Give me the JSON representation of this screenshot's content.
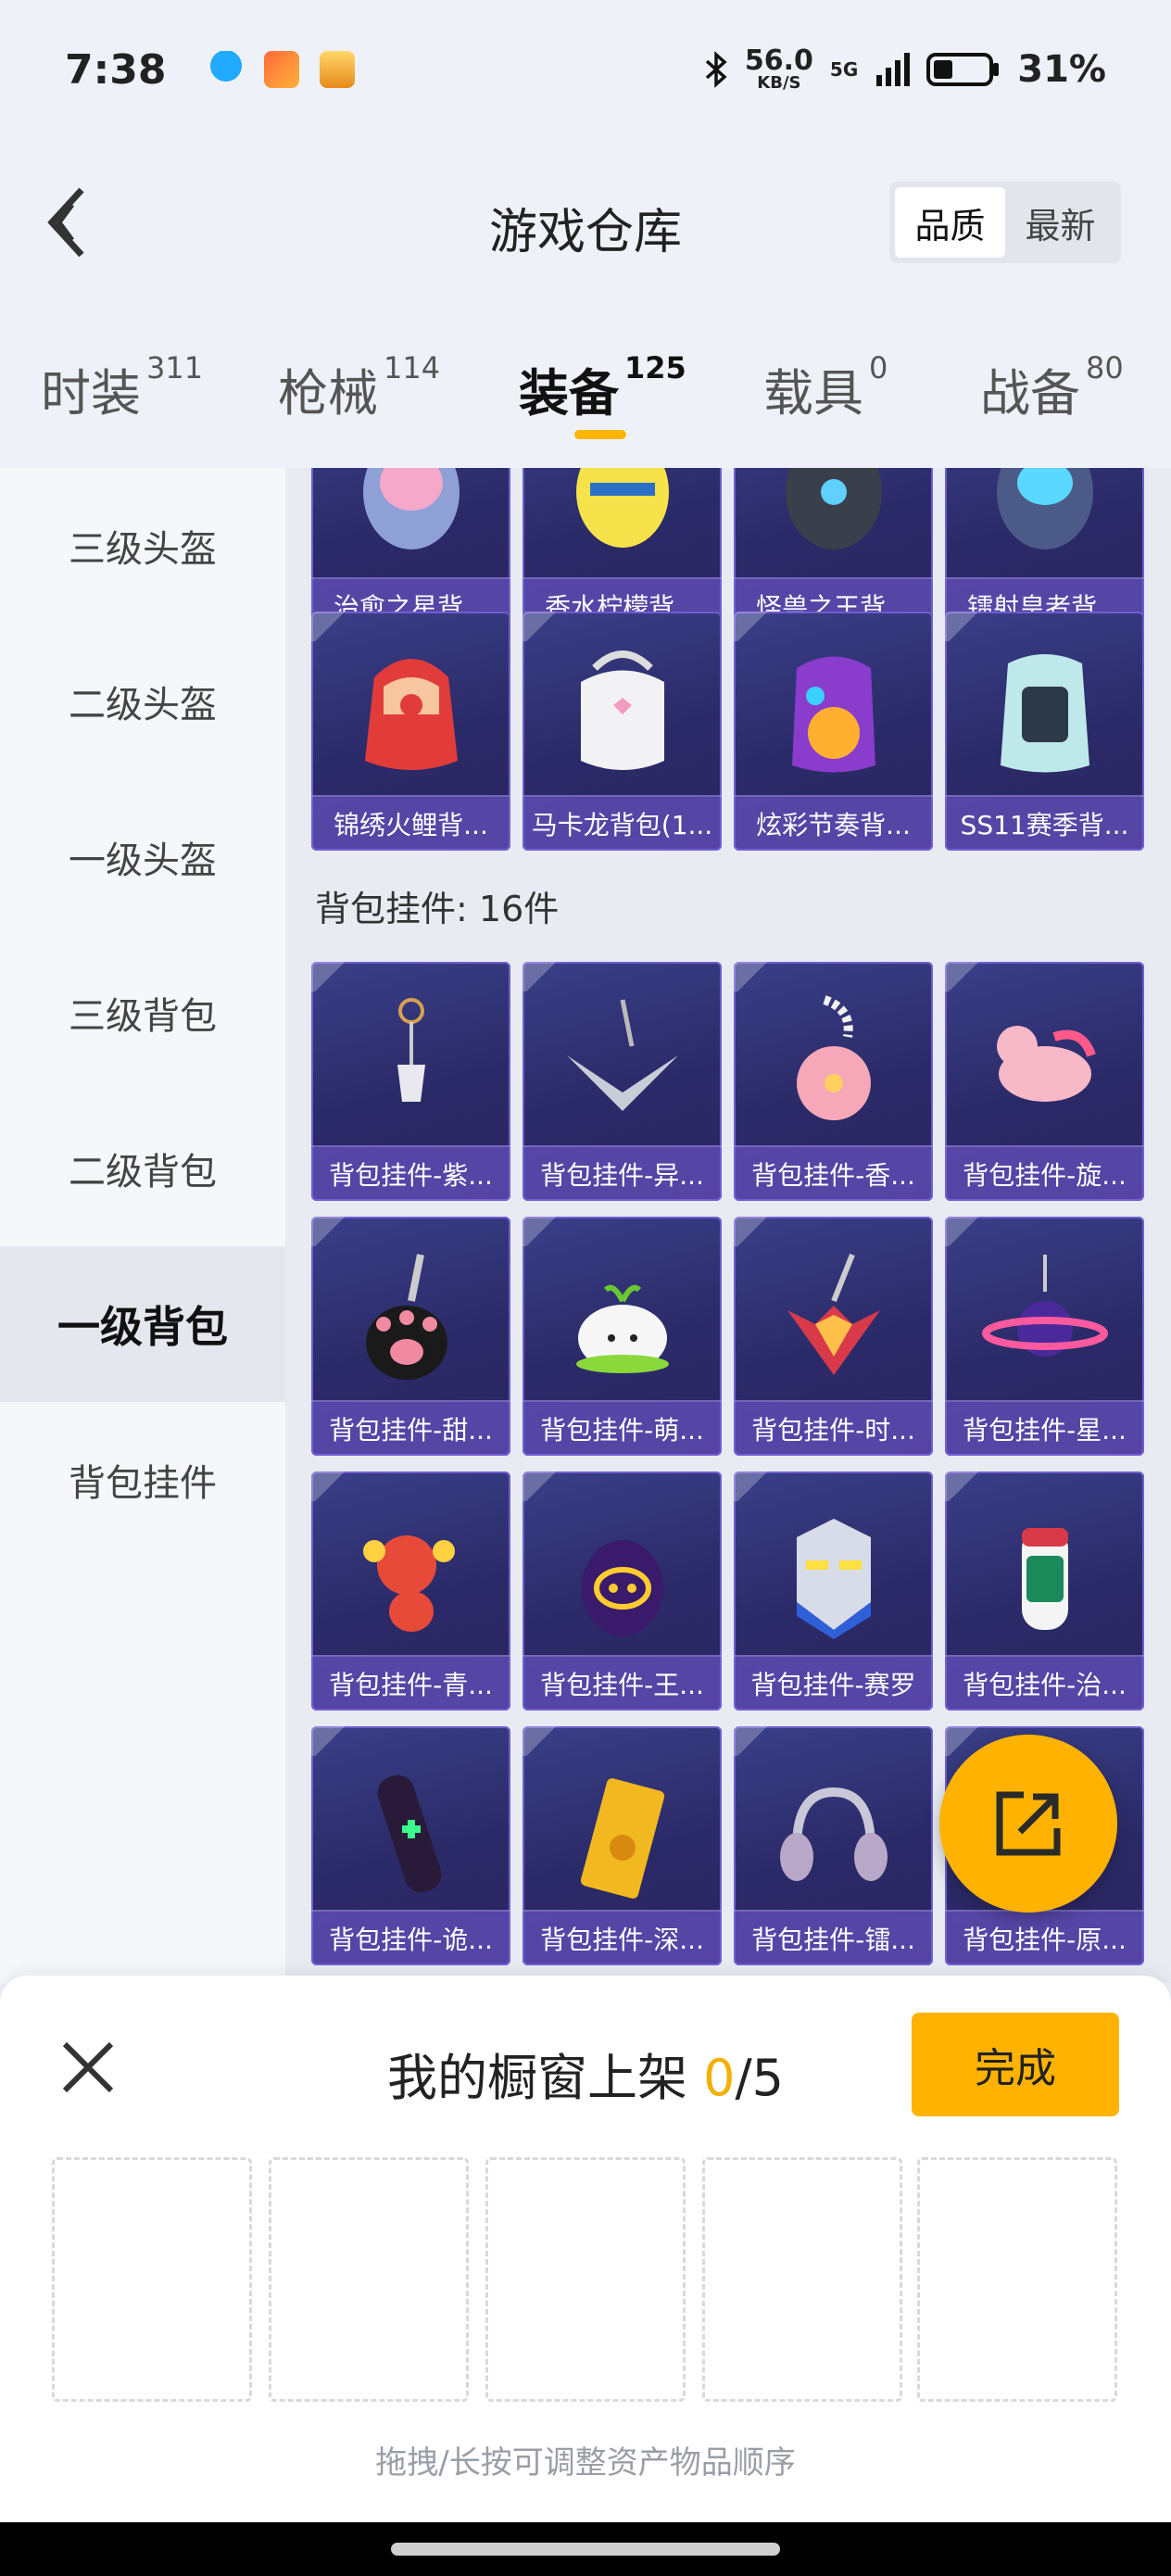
{
  "status_bar": {
    "time": "7:38",
    "net_speed": "56.0",
    "net_unit": "KB/S",
    "network": "5G",
    "battery": "31%"
  },
  "header": {
    "title": "游戏仓库",
    "sort_quality": "品质",
    "sort_latest": "最新"
  },
  "tabs": [
    {
      "label": "时装",
      "count": "311"
    },
    {
      "label": "枪械",
      "count": "114"
    },
    {
      "label": "装备",
      "count": "125"
    },
    {
      "label": "载具",
      "count": "0"
    },
    {
      "label": "战备",
      "count": "80"
    }
  ],
  "sidebar": [
    "三级头盔",
    "二级头盔",
    "一级头盔",
    "三级背包",
    "二级背包",
    "一级背包",
    "背包挂件"
  ],
  "backpack_rows": [
    [
      "治愈之星背...",
      "香水柠檬背...",
      "怪兽之王背...",
      "镭射皇者背..."
    ],
    [
      "锦绣火鲤背...",
      "马卡龙背包(1...",
      "炫彩节奏背...",
      "SS11赛季背..."
    ]
  ],
  "section": {
    "label": "背包挂件",
    "count": "16件"
  },
  "pendants": [
    "背包挂件-紫...",
    "背包挂件-异...",
    "背包挂件-香...",
    "背包挂件-旋...",
    "背包挂件-甜...",
    "背包挂件-萌...",
    "背包挂件-时...",
    "背包挂件-星...",
    "背包挂件-青...",
    "背包挂件-王...",
    "背包挂件-赛罗",
    "背包挂件-治...",
    "背包挂件-诡...",
    "背包挂件-深...",
    "背包挂件-镭...",
    "背包挂件-原..."
  ],
  "panel": {
    "title": "我的橱窗上架",
    "count": "0",
    "total": "/5",
    "done": "完成",
    "hint": "拖拽/长按可调整资产物品顺序"
  },
  "colors": {
    "accent": "#ffb300",
    "card": "#2e2c6c",
    "card_label": "#7a60d8"
  }
}
